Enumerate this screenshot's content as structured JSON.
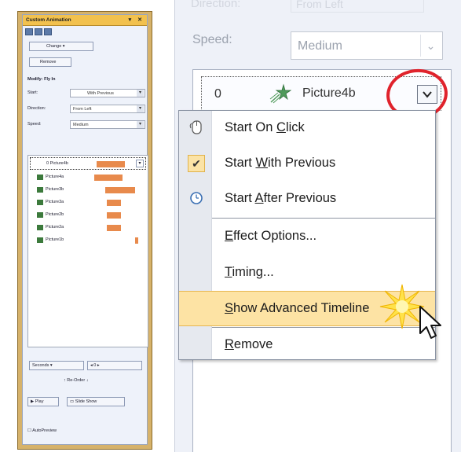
{
  "mini_pane": {
    "title": "Custom Animation",
    "change_label": "Change",
    "remove_label": "Remove",
    "modify_label": "Modify: Fly In",
    "start_label": "Start:",
    "start_value": "With Previous",
    "direction_label": "Direction:",
    "direction_value": "From Left",
    "speed_label": "Speed:",
    "speed_value": "Medium",
    "items": [
      {
        "label": "0 Picture4b"
      },
      {
        "label": "Picture4a"
      },
      {
        "label": "Picture3b"
      },
      {
        "label": "Picture3a"
      },
      {
        "label": "Picture2b"
      },
      {
        "label": "Picture2a"
      },
      {
        "label": "Picture1b"
      }
    ],
    "seconds_label": "Seconds",
    "reorder_label": "Re-Order",
    "play_label": "Play",
    "slideshow_label": "Slide Show",
    "autopreview_label": "AutoPreview"
  },
  "zoom_pane": {
    "ghost_label": "Direction:",
    "ghost_value": "From Left",
    "speed_label": "Speed:",
    "speed_value": "Medium",
    "item_number": "0",
    "item_name": "Picture4b"
  },
  "menu": {
    "start_on_click": {
      "pre": "Start On ",
      "u": "C",
      "post": "lick"
    },
    "start_with_previous": {
      "pre": "Start ",
      "u": "W",
      "post": "ith Previous"
    },
    "start_after_previous": {
      "pre": "Start ",
      "u": "A",
      "post": "fter Previous"
    },
    "effect_options": {
      "pre": "",
      "u": "E",
      "post": "ffect Options..."
    },
    "timing": {
      "pre": "",
      "u": "T",
      "post": "iming..."
    },
    "show_advanced_timeline": {
      "pre": "",
      "u": "S",
      "post": "how Advanced Timeline"
    },
    "remove": {
      "pre": "",
      "u": "R",
      "post": "emove"
    }
  },
  "colors": {
    "highlight": "#fde3a4",
    "annotation_circle": "#e0232c",
    "timeline_bar": "#e88a4c"
  },
  "icons": {
    "start_on_click": "mouse-icon",
    "start_with_previous": "checkmark-icon",
    "start_after_previous": "clock-icon"
  }
}
